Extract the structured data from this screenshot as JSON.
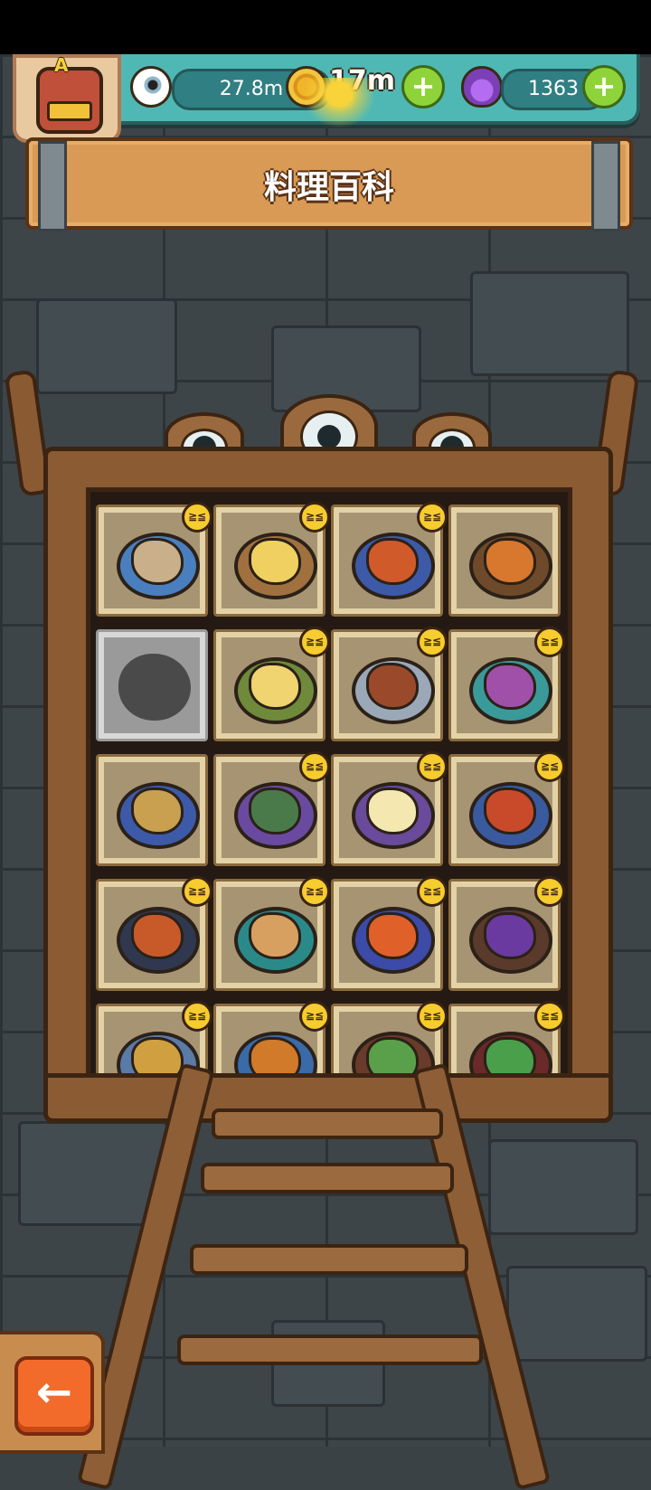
{
  "resources": {
    "eyes": "27.8m",
    "coins": "17m",
    "potions": "1363"
  },
  "avatar": {
    "letter": "A"
  },
  "title": "料理百科",
  "back_icon": "←",
  "plus_icon": "+",
  "dishes": [
    {
      "name": "dish-1",
      "plate": "#4a7fbf",
      "food": "#c9b08a",
      "badge": true,
      "locked": false
    },
    {
      "name": "dish-2",
      "plate": "#a0703e",
      "food": "#f0d060",
      "badge": true,
      "locked": false
    },
    {
      "name": "dish-3",
      "plate": "#3c5aa8",
      "food": "#d05a2a",
      "badge": true,
      "locked": false
    },
    {
      "name": "dish-4",
      "plate": "#6e4a2a",
      "food": "#d8772e",
      "badge": false,
      "locked": false
    },
    {
      "name": "dish-5",
      "plate": "#555",
      "food": "#444",
      "badge": false,
      "locked": true
    },
    {
      "name": "dish-6",
      "plate": "#6f8a3a",
      "food": "#f0d470",
      "badge": true,
      "locked": false
    },
    {
      "name": "dish-7",
      "plate": "#9aa8b8",
      "food": "#9a4a2a",
      "badge": true,
      "locked": false
    },
    {
      "name": "dish-8",
      "plate": "#3a9a9a",
      "food": "#a050a8",
      "badge": true,
      "locked": false
    },
    {
      "name": "dish-9",
      "plate": "#3c5aa8",
      "food": "#c8a050",
      "badge": false,
      "locked": false
    },
    {
      "name": "dish-10",
      "plate": "#6a4aa0",
      "food": "#4a7a4a",
      "badge": true,
      "locked": false
    },
    {
      "name": "dish-11",
      "plate": "#6a4a9a",
      "food": "#f4e8b0",
      "badge": true,
      "locked": false
    },
    {
      "name": "dish-12",
      "plate": "#3a5aa0",
      "food": "#c84a2a",
      "badge": true,
      "locked": false
    },
    {
      "name": "dish-13",
      "plate": "#303850",
      "food": "#c85a2a",
      "badge": true,
      "locked": false
    },
    {
      "name": "dish-14",
      "plate": "#2a8a8a",
      "food": "#d8a060",
      "badge": true,
      "locked": false
    },
    {
      "name": "dish-15",
      "plate": "#3c4aa8",
      "food": "#e0602a",
      "badge": true,
      "locked": false
    },
    {
      "name": "dish-16",
      "plate": "#5a3a2a",
      "food": "#6a3aa0",
      "badge": true,
      "locked": false
    },
    {
      "name": "dish-17",
      "plate": "#5a7aa8",
      "food": "#d0a040",
      "badge": true,
      "locked": false
    },
    {
      "name": "dish-18",
      "plate": "#3a6aa8",
      "food": "#d07a2a",
      "badge": true,
      "locked": false
    },
    {
      "name": "dish-19",
      "plate": "#6a3a2a",
      "food": "#5aa04a",
      "badge": true,
      "locked": false
    },
    {
      "name": "dish-20",
      "plate": "#6a2a2a",
      "food": "#4aa04a",
      "badge": true,
      "locked": false
    }
  ]
}
